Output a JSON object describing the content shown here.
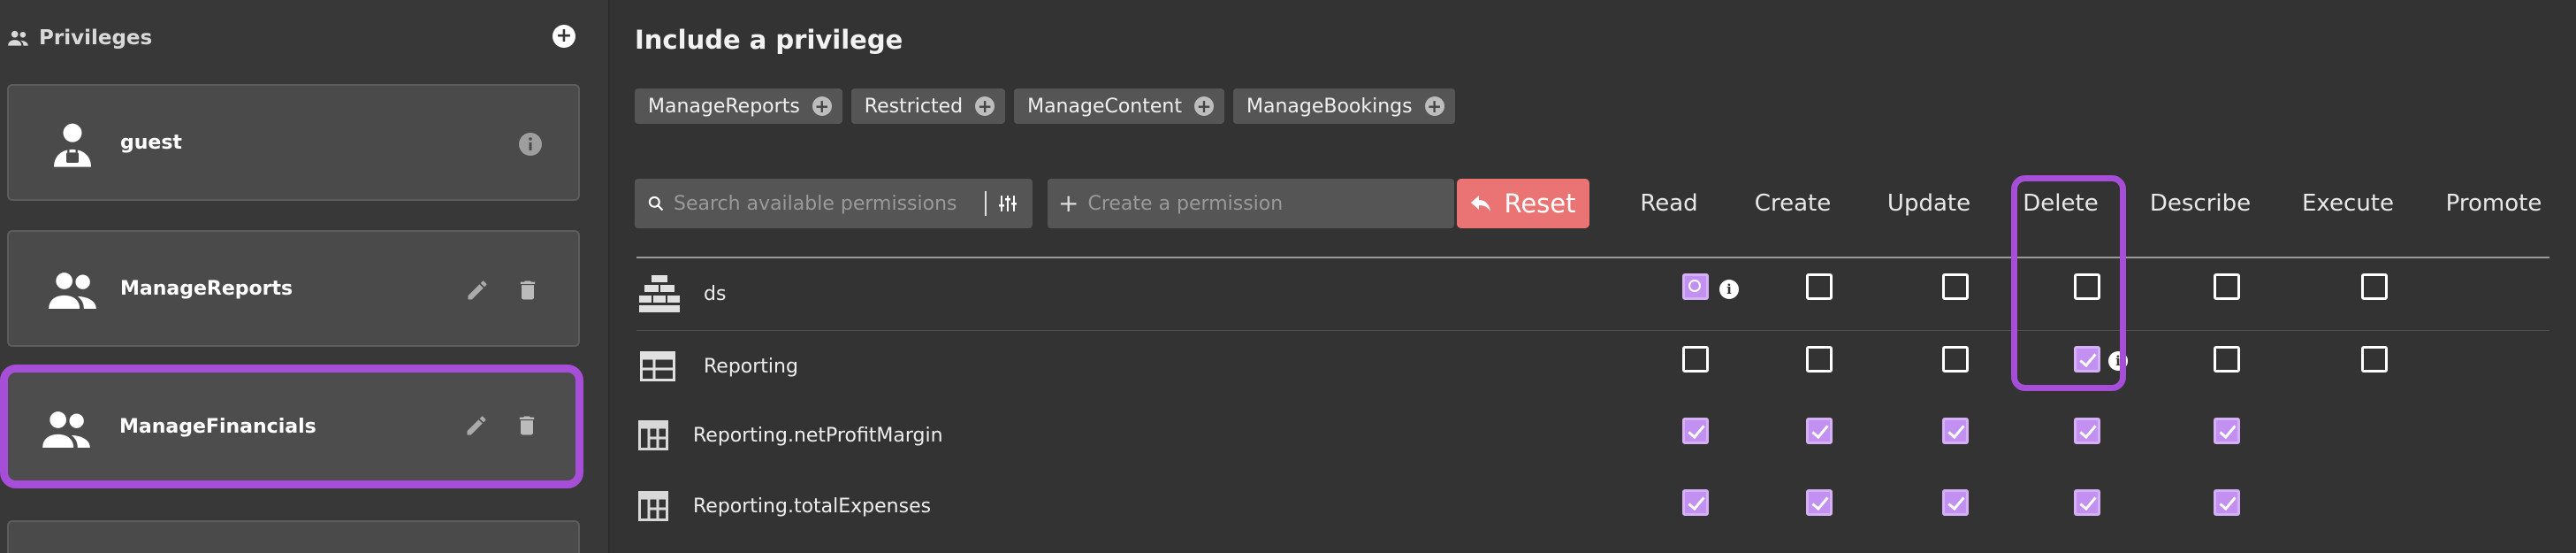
{
  "sidebar": {
    "title": "Privileges",
    "add_icon": "plus-circle-icon",
    "items": [
      {
        "name": "guest",
        "icon": "guest-lock-user-icon",
        "actions": [
          "info-icon"
        ]
      },
      {
        "name": "ManageReports",
        "icon": "people-icon",
        "actions": [
          "edit-icon",
          "delete-icon"
        ]
      },
      {
        "name": "ManageFinancials",
        "icon": "people-icon",
        "actions": [
          "edit-icon",
          "delete-icon"
        ],
        "selected": true
      }
    ]
  },
  "main": {
    "title": "Include a privilege",
    "chips": [
      "ManageReports",
      "Restricted",
      "ManageContent",
      "ManageBookings"
    ],
    "search_placeholder": "Search available permissions",
    "create_placeholder": "Create a permission",
    "reset_label": "Reset",
    "columns": [
      "Read",
      "Create",
      "Update",
      "Delete",
      "Describe",
      "Execute",
      "Promote"
    ],
    "highlighted_column": "Delete",
    "rows": [
      {
        "name": "ds",
        "icon": "database-stack-icon",
        "cells": {
          "Read": "partial-info",
          "Create": "unchecked",
          "Update": "unchecked",
          "Delete": "unchecked",
          "Describe": "unchecked",
          "Execute": "unchecked",
          "Promote": "none"
        }
      },
      {
        "name": "Reporting",
        "icon": "table-icon",
        "cells": {
          "Read": "unchecked",
          "Create": "unchecked",
          "Update": "unchecked",
          "Delete": "checked-info",
          "Describe": "unchecked",
          "Execute": "unchecked",
          "Promote": "none"
        }
      },
      {
        "name": "Reporting.netProfitMargin",
        "icon": "column-table-icon",
        "cells": {
          "Read": "checked",
          "Create": "checked",
          "Update": "checked",
          "Delete": "checked",
          "Describe": "checked",
          "Execute": "none",
          "Promote": "none"
        }
      },
      {
        "name": "Reporting.totalExpenses",
        "icon": "column-table-icon",
        "cells": {
          "Read": "checked",
          "Create": "checked",
          "Update": "checked",
          "Delete": "checked",
          "Describe": "checked",
          "Execute": "none",
          "Promote": "none"
        }
      }
    ]
  },
  "colors": {
    "accent": "#a64ed8",
    "checkbox": "#c290f0",
    "reset": "#ea7474"
  }
}
